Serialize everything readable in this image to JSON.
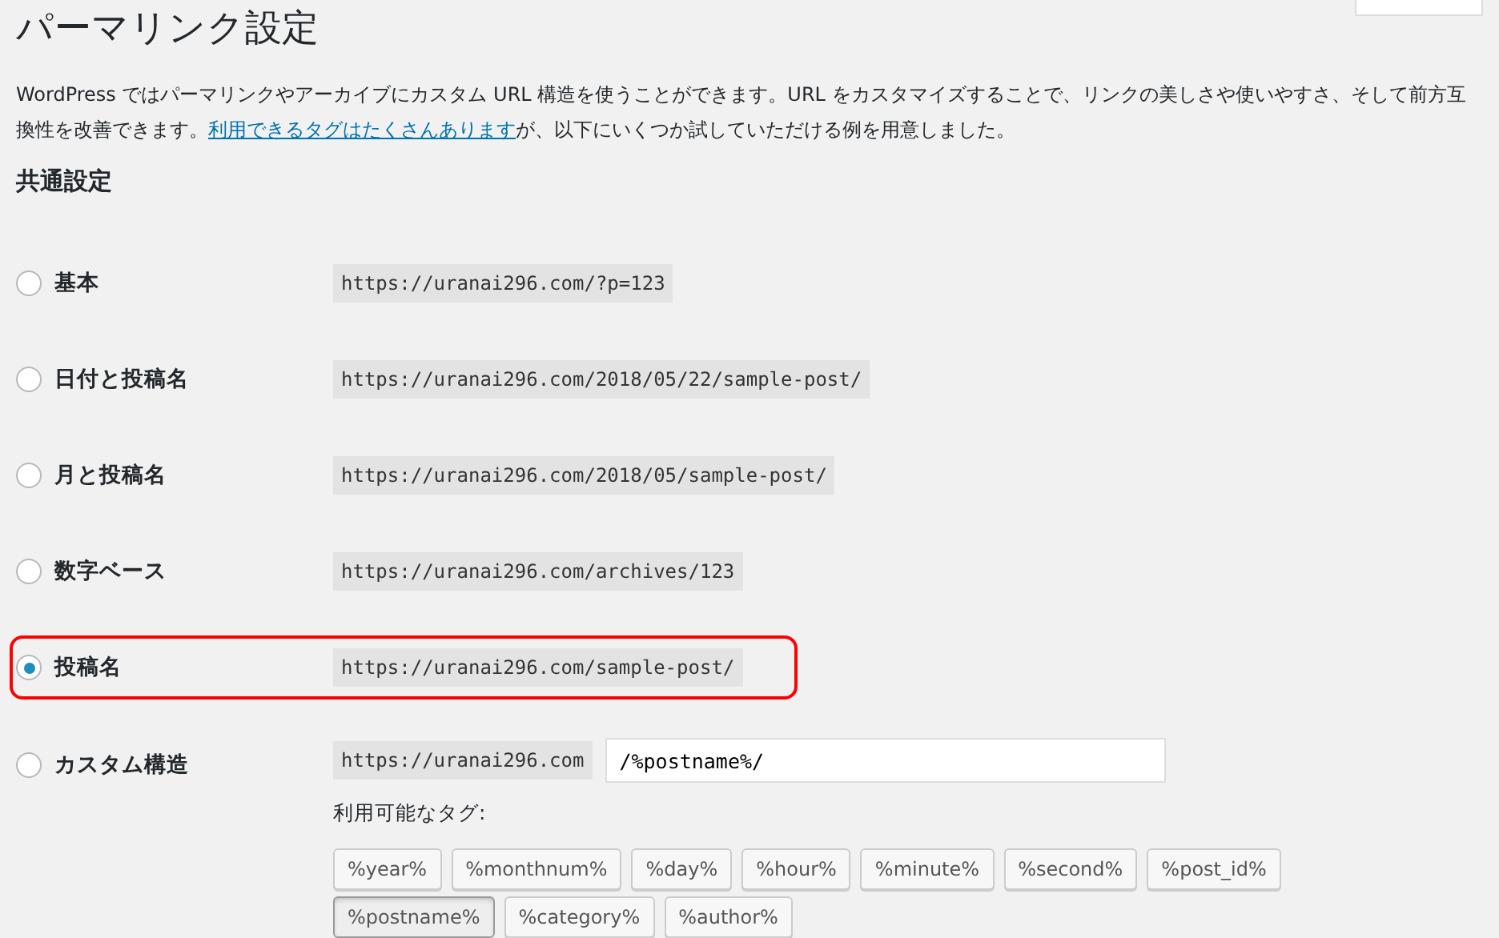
{
  "page_title": "パーマリンク設定",
  "help_tab": {
    "kind": "tab"
  },
  "intro": {
    "before": "WordPress ではパーマリンクやアーカイブにカスタム URL 構造を使うことができます。URL をカスタマイズすることで、リンクの美しさや使いやすさ、そして前方互換性を改善できます。",
    "link": "利用できるタグはたくさんあります",
    "after": "が、以下にいくつか試していただける例を用意しました。"
  },
  "section_title": "共通設定",
  "options": [
    {
      "label": "基本",
      "example": "https://uranai296.com/?p=123",
      "selected": false,
      "highlighted": false
    },
    {
      "label": "日付と投稿名",
      "example": "https://uranai296.com/2018/05/22/sample-post/",
      "selected": false,
      "highlighted": false
    },
    {
      "label": "月と投稿名",
      "example": "https://uranai296.com/2018/05/sample-post/",
      "selected": false,
      "highlighted": false
    },
    {
      "label": "数字ベース",
      "example": "https://uranai296.com/archives/123",
      "selected": false,
      "highlighted": false
    },
    {
      "label": "投稿名",
      "example": "https://uranai296.com/sample-post/",
      "selected": true,
      "highlighted": true
    }
  ],
  "custom": {
    "label": "カスタム構造",
    "selected": false,
    "base": "https://uranai296.com",
    "value": "/%postname%/",
    "tags_label": "利用可能なタグ:",
    "tags": [
      {
        "label": "%year%",
        "selected": false
      },
      {
        "label": "%monthnum%",
        "selected": false
      },
      {
        "label": "%day%",
        "selected": false
      },
      {
        "label": "%hour%",
        "selected": false
      },
      {
        "label": "%minute%",
        "selected": false
      },
      {
        "label": "%second%",
        "selected": false
      },
      {
        "label": "%post_id%",
        "selected": false
      },
      {
        "label": "%postname%",
        "selected": true
      },
      {
        "label": "%category%",
        "selected": false
      },
      {
        "label": "%author%",
        "selected": false
      }
    ]
  }
}
